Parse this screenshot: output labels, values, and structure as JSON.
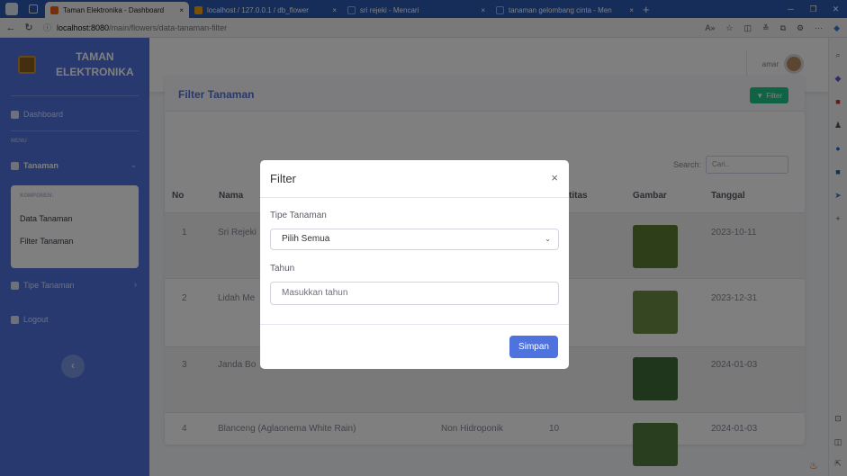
{
  "browser": {
    "tabs": [
      {
        "title": "Taman Elektronika - Dashboard",
        "active": true,
        "favicon_color": "#e8611a"
      },
      {
        "title": "localhost / 127.0.0.1 / db_flower",
        "active": false,
        "favicon_color": "#f0a30a"
      },
      {
        "title": "sri rejeki - Mencari",
        "active": false,
        "favicon_color": "#2b5bb0"
      },
      {
        "title": "tanaman gelombang cinta - Men",
        "active": false,
        "favicon_color": "#2b5bb0"
      }
    ],
    "close_glyph": "×",
    "new_tab_glyph": "+",
    "url_host": "localhost:8080",
    "url_path": "/main/flowers/data-tanaman-filter"
  },
  "app": {
    "brand_line1": "TAMAN",
    "brand_line2": "ELEKTRONIKA",
    "sidebar": {
      "dashboard": "Dashboard",
      "menu_heading": "MENU",
      "tanaman": "Tanaman",
      "submenu_heading": "KOMPONEN:",
      "submenu_items": [
        "Data Tanaman",
        "Filter Tanaman"
      ],
      "tipe_tanaman": "Tipe Tanaman",
      "logout": "Logout"
    },
    "topbar": {
      "user": "amar"
    },
    "card": {
      "title": "Filter Tanaman",
      "filter_button": "Filter",
      "search_label": "Search:",
      "search_placeholder": "Cari..",
      "columns": [
        "No",
        "Nama",
        "titas",
        "Gambar",
        "Tanggal"
      ],
      "rows": [
        {
          "no": "1",
          "nama": "Sri Rejeki",
          "tipe": "",
          "kuantitas": "",
          "tanggal": "2023-10-11"
        },
        {
          "no": "2",
          "nama": "Lidah Me",
          "tipe": "",
          "kuantitas": "",
          "tanggal": "2023-12-31"
        },
        {
          "no": "3",
          "nama": "Janda Bo",
          "tipe": "",
          "kuantitas": "",
          "tanggal": "2024-01-03"
        },
        {
          "no": "4",
          "nama": "Blanceng (Aglaonema White Rain)",
          "tipe": "Non Hidroponik",
          "kuantitas": "10",
          "tanggal": "2024-01-03"
        }
      ]
    }
  },
  "modal": {
    "title": "Filter",
    "close": "×",
    "tipe_label": "Tipe Tanaman",
    "tipe_selected": "Pilih Semua",
    "tahun_label": "Tahun",
    "tahun_placeholder": "Masukkan tahun",
    "save_button": "Simpan"
  },
  "colors": {
    "primary": "#4e73df",
    "success": "#1cc88a",
    "browser": "#2b5bb0"
  }
}
